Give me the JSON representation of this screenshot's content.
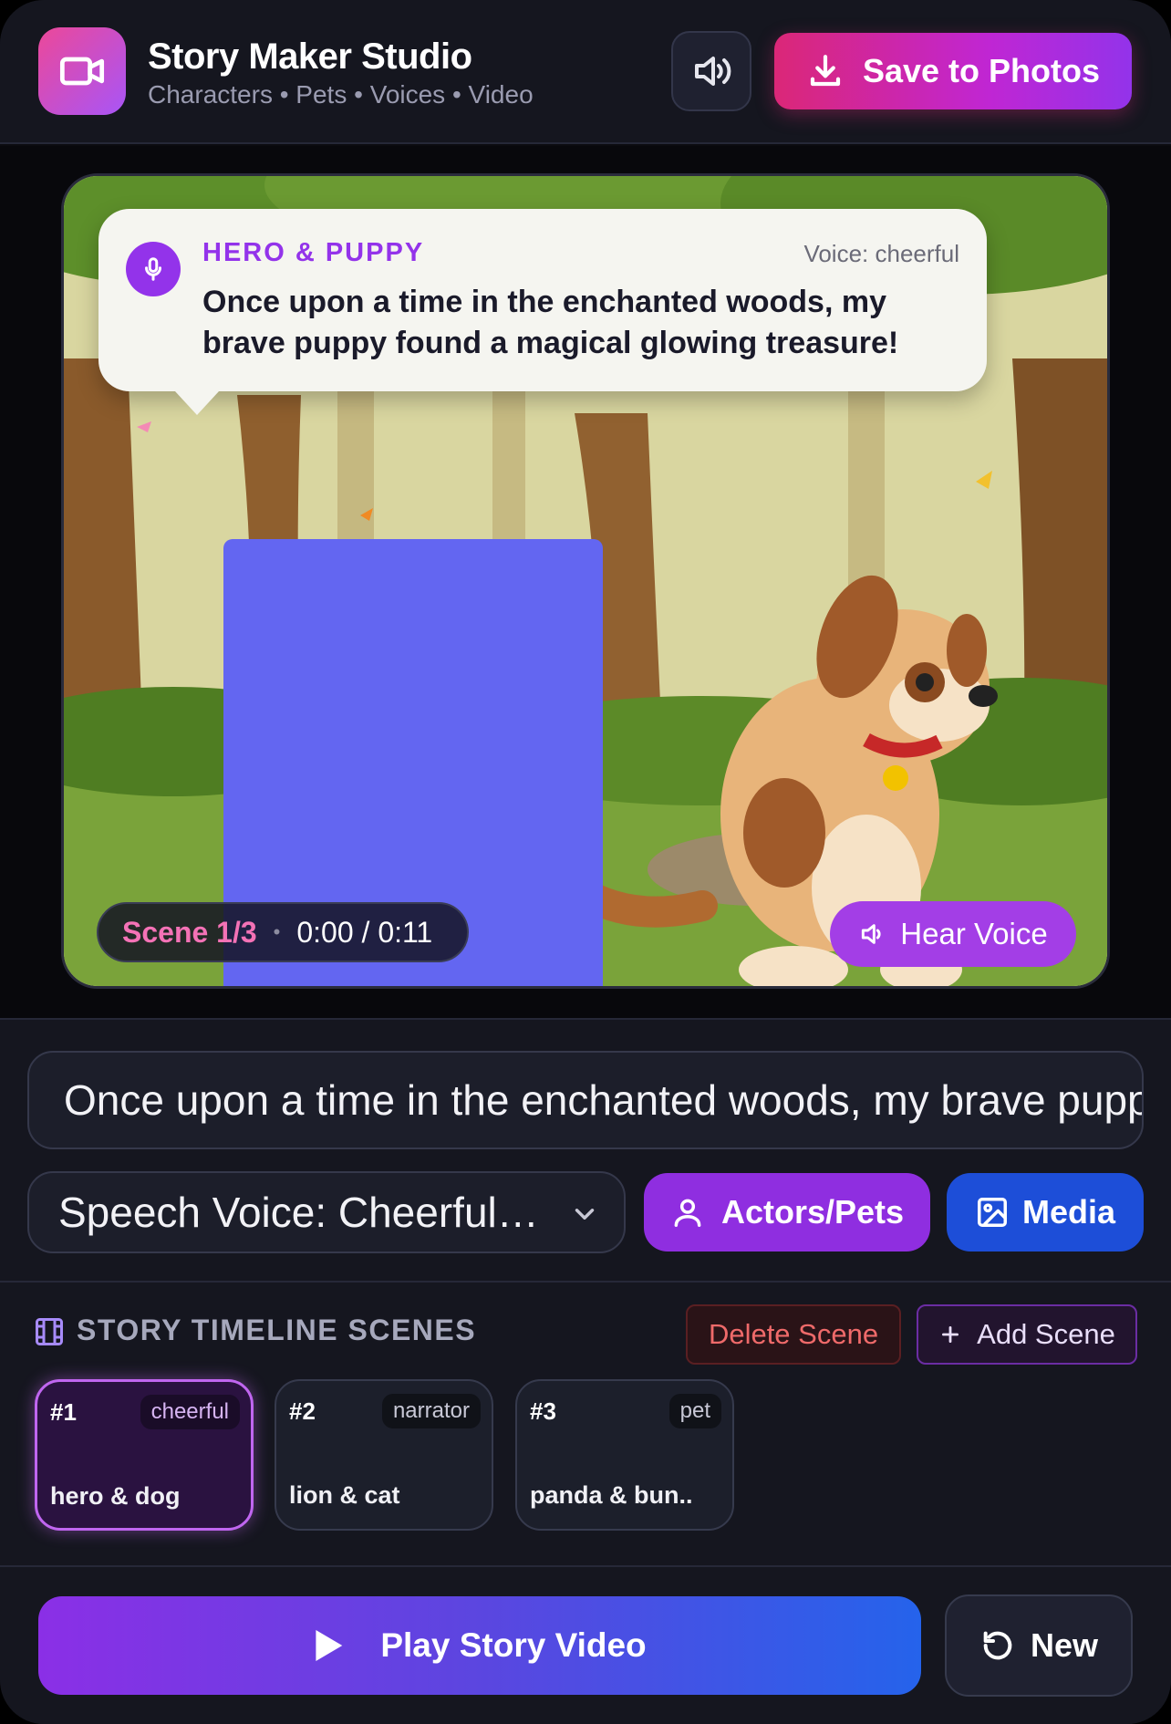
{
  "header": {
    "title": "Story Maker Studio",
    "subtitle": "Characters • Pets • Voices • Video",
    "save_label": "Save to Photos"
  },
  "stage": {
    "speaker": "HERO & PUPPY",
    "voice_tag": "Voice: cheerful",
    "caption": "Once upon a time in the enchanted woods, my brave puppy found a magical glowing treasure!",
    "scene_label": "Scene 1/3",
    "separator": "•",
    "time": "0:00 / 0:11",
    "hear_voice_label": "Hear Voice"
  },
  "controls": {
    "story_text": "Once upon a time in the enchanted woods, my brave puppy found a magical glowing treasure!",
    "voice_select": "Speech Voice: Cheerful…",
    "actors_label": "Actors/Pets",
    "media_label": "Media"
  },
  "timeline": {
    "title": "STORY TIMELINE SCENES",
    "delete_label": "Delete Scene",
    "add_label": "Add Scene",
    "scenes": [
      {
        "num": "#1",
        "tag": "cheerful",
        "name": "hero & dog",
        "active": true
      },
      {
        "num": "#2",
        "tag": "narrator",
        "name": "lion & cat",
        "active": false
      },
      {
        "num": "#3",
        "tag": "pet",
        "name": "panda & bun..",
        "active": false
      }
    ]
  },
  "footer": {
    "play_label": "Play Story Video",
    "new_label": "New"
  },
  "colors": {
    "accent_pink": "#db2777",
    "accent_purple": "#9333ea",
    "accent_blue": "#1d4ed8",
    "actor_placeholder": "#6366f1"
  },
  "icons": [
    "video-camera-icon",
    "speaker-icon",
    "download-icon",
    "microphone-icon",
    "film-icon",
    "user-icon",
    "image-icon",
    "plus-icon",
    "play-icon",
    "refresh-icon",
    "chevron-down-icon"
  ]
}
